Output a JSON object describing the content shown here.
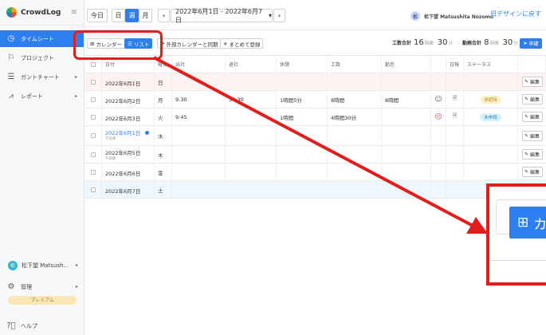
{
  "app": {
    "name": "CrowdLog",
    "menu_icon": "≡"
  },
  "sidebar": {
    "items": [
      {
        "label": "タイムシート",
        "icon": "clock-icon",
        "active": true
      },
      {
        "label": "プロジェクト",
        "icon": "flag-icon"
      },
      {
        "label": "ガントチャート",
        "icon": "gantt-icon",
        "has_arrow": true
      },
      {
        "label": "レポート",
        "icon": "chart-icon",
        "has_arrow": true
      }
    ],
    "user": {
      "avatar_text": "松",
      "name": "松下望 Matsush..."
    },
    "admin_label": "管理",
    "premium_label": "プレミアム",
    "help_label": "ヘルプ"
  },
  "topbar": {
    "today": "今日",
    "views": [
      "日",
      "週",
      "月"
    ],
    "selected_view": "週",
    "prev": "‹",
    "next": "›",
    "date_range": "2022年6月1日 - 2022年6月7日",
    "dropdown_caret": "▾",
    "user_avatar": "松",
    "user_name": "松下望 Matsushita Nozomu",
    "old_design_link": "旧デザインに戻す"
  },
  "toolbar": {
    "calendar_label": "カレンダー",
    "list_label": "リスト",
    "sync_label": "外部カレンダーと同期",
    "bulk_label": "まとめて登録",
    "work_total_label": "工数合計",
    "work_total_h": "16",
    "work_total_m": "30",
    "attend_total_label": "勤務合計",
    "attend_total_h": "8",
    "attend_total_m": "30",
    "hour_unit": "時間",
    "min_unit": "分",
    "apply_label": "申請"
  },
  "table": {
    "headers": [
      "日付",
      "曜日",
      "出社",
      "退社",
      "休憩",
      "工数",
      "勤怠",
      "",
      "日報",
      "ステータス",
      ""
    ],
    "rows": [
      {
        "date": "2022年6月1日",
        "dow": "日",
        "in": "",
        "out": "",
        "rest": "",
        "work": "",
        "attend": "",
        "mood": "",
        "report": "",
        "status": "",
        "edit": "編集",
        "holiday": true
      },
      {
        "date": "2022年6月2日",
        "dow": "月",
        "in": "9:30",
        "out": "18:30",
        "rest": "1時間5分",
        "work": "8時間",
        "attend": "8時間",
        "mood": "☺",
        "report": "🗎",
        "status": "承認待",
        "status_color": "#fdf1c9",
        "status_text_color": "#b88a1a",
        "edit": "編集"
      },
      {
        "date": "2022年6月3日",
        "dow": "火",
        "in": "9:45",
        "out": "",
        "rest": "1時間",
        "work": "4時間30分",
        "attend": "",
        "mood": "☹",
        "mood_color": "#e74c3c",
        "report": "🗎",
        "status": "未申請",
        "status_color": "#d6f0fb",
        "status_text_color": "#2a8fb8",
        "edit": "編集"
      },
      {
        "date": "2022年6月1日",
        "sub": "午前休",
        "dow": "水",
        "in": "",
        "out": "",
        "rest": "",
        "work": "",
        "attend": "",
        "mood": "",
        "report": "",
        "status": "",
        "edit": "編集",
        "link": true
      },
      {
        "date": "2022年6月5日",
        "sub": "午前休",
        "dow": "木",
        "in": "",
        "out": "",
        "rest": "",
        "work": "",
        "attend": "",
        "mood": "",
        "report": "",
        "status": "",
        "edit": "編集"
      },
      {
        "date": "2022年6月6日",
        "dow": "金",
        "in": "",
        "out": "",
        "rest": "",
        "work": "",
        "attend": "",
        "mood": "",
        "report": "",
        "status": "",
        "edit": "編集"
      },
      {
        "date": "2022年6月7日",
        "dow": "土",
        "in": "",
        "out": "",
        "rest": "",
        "work": "",
        "attend": "",
        "mood": "",
        "report": "",
        "status": "",
        "edit": "",
        "saturday": true
      }
    ]
  },
  "zoom": {
    "icon": "grid-icon",
    "text": "カ"
  },
  "colors": {
    "accent": "#2d7ff0",
    "annotation": "#e31c1c",
    "holiday_bg": "#fdf3f3",
    "saturday_bg": "#eef7fd"
  }
}
